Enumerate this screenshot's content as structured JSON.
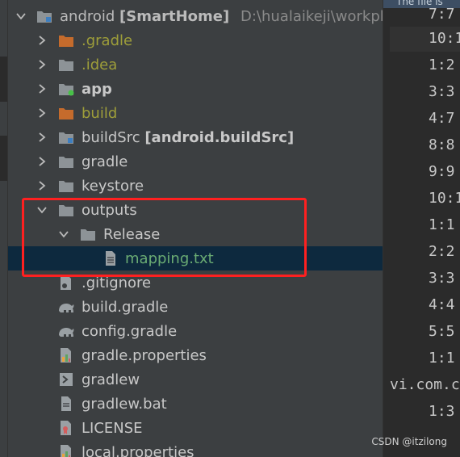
{
  "project": {
    "name": "android",
    "module": "[SmartHome]",
    "path": "D:\\hualaikeji\\workplac"
  },
  "tree": [
    {
      "label": "android",
      "icon": "module-folder-icon",
      "level": 0,
      "arrow": "down"
    },
    {
      "label": ".gradle",
      "icon": "folder-orange-icon",
      "level": 1,
      "arrow": "right"
    },
    {
      "label": ".idea",
      "icon": "folder-gray-icon",
      "level": 1,
      "arrow": "right"
    },
    {
      "label": "app",
      "icon": "module-folder-icon",
      "level": 1,
      "arrow": "right"
    },
    {
      "label": "build",
      "icon": "folder-orange-icon",
      "level": 1,
      "arrow": "right"
    },
    {
      "label": "buildSrc",
      "extra": "[android.buildSrc]",
      "icon": "module-folder-icon",
      "level": 1,
      "arrow": "right"
    },
    {
      "label": "gradle",
      "icon": "folder-gray-icon",
      "level": 1,
      "arrow": "right"
    },
    {
      "label": "keystore",
      "icon": "folder-gray-icon",
      "level": 1,
      "arrow": "right"
    },
    {
      "label": "outputs",
      "icon": "folder-gray-icon",
      "level": 1,
      "arrow": "down"
    },
    {
      "label": "Release",
      "icon": "folder-gray-icon",
      "level": 2,
      "arrow": "down"
    },
    {
      "label": "mapping.txt",
      "icon": "text-file-icon",
      "level": 3,
      "selected": true
    },
    {
      "label": ".gitignore",
      "icon": "gitignore-file-icon",
      "level": 1
    },
    {
      "label": "build.gradle",
      "icon": "gradle-elephant-icon",
      "level": 1
    },
    {
      "label": "config.gradle",
      "icon": "gradle-elephant-icon",
      "level": 1
    },
    {
      "label": "gradle.properties",
      "icon": "properties-file-icon",
      "level": 1
    },
    {
      "label": "gradlew",
      "icon": "shell-script-icon",
      "level": 1
    },
    {
      "label": "gradlew.bat",
      "icon": "file-icon",
      "level": 1
    },
    {
      "label": "LICENSE",
      "icon": "license-file-icon",
      "level": 1
    },
    {
      "label": "local.properties",
      "icon": "properties-file-icon",
      "level": 1
    }
  ],
  "editor": {
    "banner": "The file is",
    "lines": [
      "7:7",
      "10:1",
      "1:2",
      "3:3",
      "4:7",
      "8:8",
      "9:9",
      "10:1",
      "1:1",
      "2:2",
      "3:3",
      "4:4",
      "5:5",
      "1:1",
      "vi.com.c",
      "1:3"
    ]
  },
  "watermark": "CSDN @itzilong",
  "colors": {
    "panel_bg": "#3c3f41",
    "editor_bg": "#2b2b2b",
    "selected_row": "#0d293e",
    "ignored_text": "#9e9e3a",
    "new_file_text": "#6aab73",
    "highlight_box": "#ff2020"
  }
}
